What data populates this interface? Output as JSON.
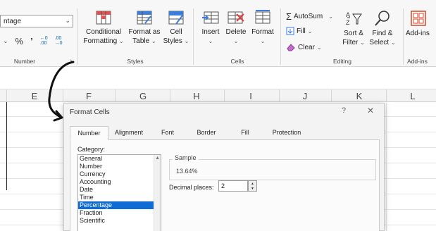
{
  "ribbon": {
    "number_format_value": "ntage",
    "number_group_label": "Number",
    "styles": {
      "conditional_line1": "Conditional",
      "conditional_line2": "Formatting",
      "format_table_line1": "Format as",
      "format_table_line2": "Table",
      "cell_styles_line1": "Cell",
      "cell_styles_line2": "Styles",
      "label": "Styles"
    },
    "cells": {
      "insert": "Insert",
      "delete": "Delete",
      "format": "Format",
      "label": "Cells"
    },
    "editing": {
      "autosum": "AutoSum",
      "fill": "Fill",
      "clear": "Clear",
      "sort_line1": "Sort &",
      "sort_line2": "Filter",
      "find_line1": "Find &",
      "find_line2": "Select",
      "label": "Editing"
    },
    "addins": {
      "line1": "Add-ins",
      "label": "Add-ins"
    }
  },
  "sheet": {
    "columns": [
      "E",
      "F",
      "G",
      "H",
      "I",
      "J",
      "K",
      "L"
    ]
  },
  "dialog": {
    "title": "Format Cells",
    "help": "?",
    "close": "✕",
    "tabs": [
      "Number",
      "Alignment",
      "Font",
      "Border",
      "Fill",
      "Protection"
    ],
    "category_label": "Category:",
    "categories": [
      "General",
      "Number",
      "Currency",
      "Accounting",
      "Date",
      "Time",
      "Percentage",
      "Fraction",
      "Scientific"
    ],
    "selected_category": "Percentage",
    "sample_label": "Sample",
    "sample_value": "13.64%",
    "decimal_label": "Decimal places:",
    "decimal_value": "2"
  },
  "colors": {
    "selection": "#0f6cd4",
    "ribbon_bg": "#f7f7f7",
    "dialog_bg": "#f3f3f3"
  },
  "icons": [
    "percent-icon",
    "comma-icon",
    "increase-decimal-icon",
    "decrease-decimal-icon",
    "dialog-launcher-icon",
    "conditional-formatting-icon",
    "format-as-table-icon",
    "cell-styles-icon",
    "insert-cells-icon",
    "delete-cells-icon",
    "format-cells-icon",
    "autosum-icon",
    "fill-icon",
    "clear-icon",
    "sort-filter-icon",
    "find-select-icon",
    "add-ins-icon",
    "curved-arrow-icon"
  ]
}
